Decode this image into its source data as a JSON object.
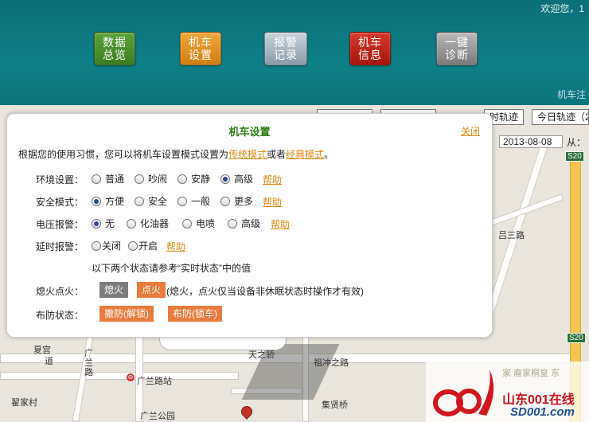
{
  "header": {
    "welcome": "欢迎您，1",
    "sub_label": "机车注",
    "nav": [
      {
        "label": "数据\n总览",
        "color": "#4a9a2e"
      },
      {
        "label": "机车\n设置",
        "color": "#e69424"
      },
      {
        "label": "报警\n记录",
        "color": "#a8b6c0"
      },
      {
        "label": "机车\n信息",
        "color": "#c0261a"
      },
      {
        "label": "一键\n诊断",
        "color": "#9c9c9c"
      }
    ]
  },
  "map": {
    "toolbar": {
      "track": "时轨迹",
      "today_track": "今日轨迹（2"
    },
    "date": "2013-08-08",
    "from_label": "从：",
    "road_tags": [
      "S20",
      "S20"
    ],
    "labels": {
      "street1": "吕三路",
      "street2": "夏宫",
      "street3": "广兰路",
      "street4": "广兰路站",
      "street5": "翟家村",
      "street6": "广兰公园",
      "street7": "集贤桥",
      "street8": "祖冲之路",
      "street9": "天之骄",
      "street10": "道"
    }
  },
  "dialog": {
    "title": "机车设置",
    "close": "关闭",
    "intro_prefix": "根据您的使用习惯，您可以将机车设置模式设置为",
    "intro_link1": "传统模式",
    "intro_mid": "或者",
    "intro_link2": "经典模式",
    "intro_suffix": "。",
    "help": "帮助",
    "rows": [
      {
        "label": "环境设置：",
        "options": [
          "普通",
          "吵闹",
          "安静",
          "高级"
        ],
        "selected": 3
      },
      {
        "label": "安全模式：",
        "options": [
          "方便",
          "安全",
          "一般",
          "更多"
        ],
        "selected": 0
      },
      {
        "label": "电压报警：",
        "options": [
          "无",
          "化油器",
          "电喷",
          "高级"
        ],
        "selected": 0
      },
      {
        "label": "延时报警：",
        "options": [
          "关闭",
          "开启"
        ],
        "selected": -1
      }
    ],
    "note": "以下两个状态请参考“实时状态”中的值",
    "ignition": {
      "label": "熄火点火：",
      "off": "熄火",
      "on": "点火",
      "desc": "(熄火，点火仅当设备非休眠状态时操作才有效)"
    },
    "arming": {
      "label": "布防状态：",
      "disarm": "撤防(解锁)",
      "arm": "布防(锁车)"
    }
  },
  "watermark": {
    "top": "家 裔家桐皇 东",
    "brand": "山东001在线",
    "url": "SD001.com"
  }
}
